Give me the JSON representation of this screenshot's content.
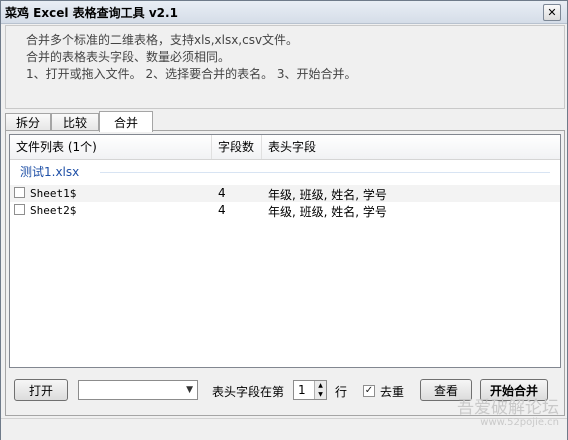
{
  "window": {
    "title": "菜鸡 Excel 表格查询工具 v2.1",
    "close_glyph": "✕"
  },
  "info": {
    "line1": "合并多个标准的二维表格，支持xls,xlsx,csv文件。",
    "line2": "合并的表格表头字段、数量必须相同。",
    "line3": "1、打开或拖入文件。  2、选择要合并的表名。 3、开始合并。"
  },
  "tabs": [
    {
      "label": "拆分",
      "active": false
    },
    {
      "label": "比较",
      "active": false
    },
    {
      "label": "合并",
      "active": true
    }
  ],
  "list": {
    "columns": [
      "文件列表 (1个)",
      "字段数",
      "表头字段"
    ],
    "group": "测试1.xlsx",
    "rows": [
      {
        "checked": false,
        "name": "Sheet1$",
        "count": "4",
        "fields": "年级, 班级, 姓名, 学号"
      },
      {
        "checked": false,
        "name": "Sheet2$",
        "count": "4",
        "fields": "年级, 班级, 姓名, 学号"
      }
    ]
  },
  "controls": {
    "open_label": "打开",
    "combo_value": "",
    "header_row_label": "表头字段在第",
    "header_row_value": "1",
    "row_suffix": "行",
    "dedupe_label": "去重",
    "dedupe_checked": true,
    "view_label": "查看",
    "merge_label": "开始合并"
  },
  "watermark": {
    "main": "吾爱破解论坛",
    "sub": "www.52pojie.cn"
  }
}
